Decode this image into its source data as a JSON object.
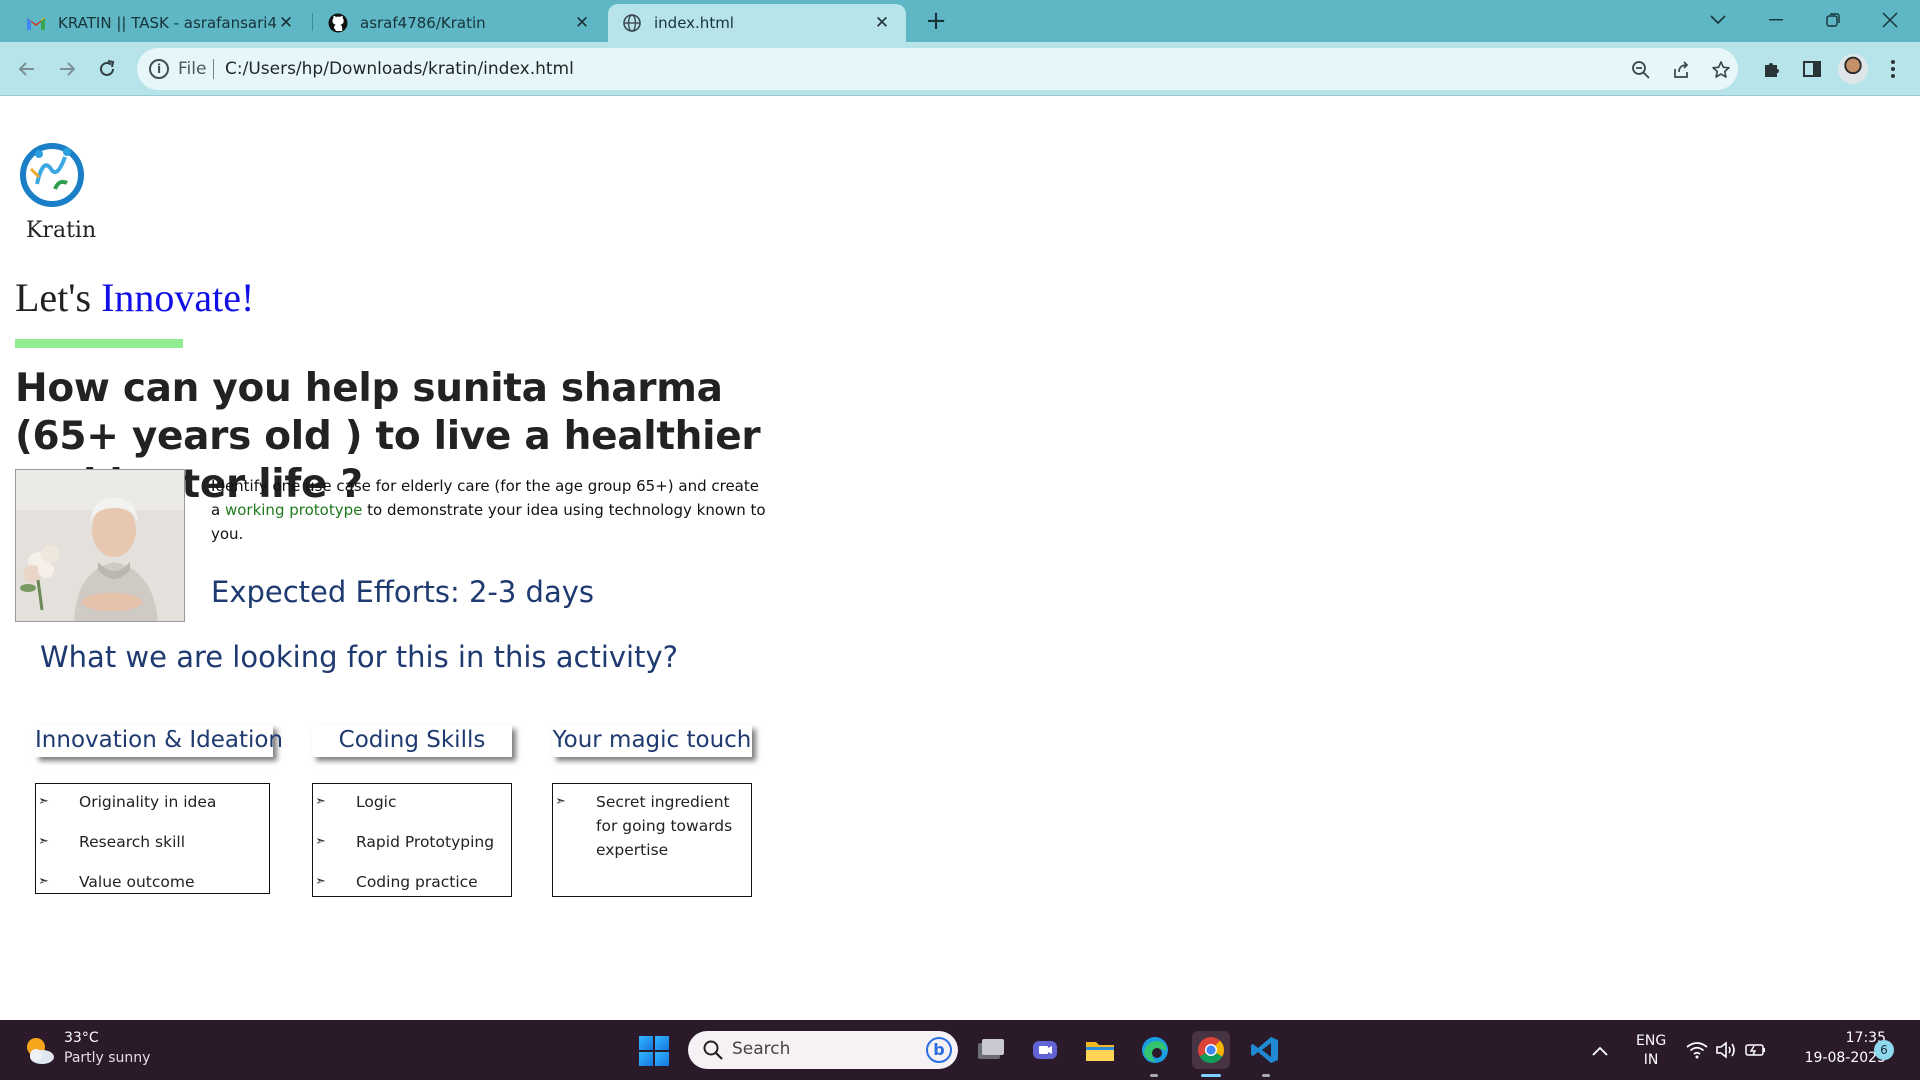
{
  "browser": {
    "tabs": [
      {
        "title": "KRATIN || TASK - asrafansari4786",
        "favicon": "gmail-icon",
        "active": false
      },
      {
        "title": "asraf4786/Kratin",
        "favicon": "github-icon",
        "active": false
      },
      {
        "title": "index.html",
        "favicon": "globe-icon",
        "active": true
      }
    ],
    "address_scheme": "File",
    "address_url": "C:/Users/hp/Downloads/kratin/index.html"
  },
  "page": {
    "logo_text": "Kratin",
    "tagline_prefix": "Let's ",
    "tagline_accent": "Innovate!",
    "challenge": "How can you help sunita sharma (65+ years old ) to live a healthier and better life ?",
    "description_before": "Identify one use case for elderly care (for the age group 65+) and create a ",
    "description_highlight": "working prototype",
    "description_after": " to demonstrate your idea using technology known to you.",
    "efforts": "Expected Efforts: 2-3 days",
    "looking_for": "What we are looking for this in this activity?",
    "cards": [
      {
        "title": "Innovation & Ideation",
        "items": [
          "Originality in idea",
          "Research skill",
          "Value outcome"
        ]
      },
      {
        "title": "Coding Skills",
        "items": [
          "Logic",
          "Rapid Prototyping",
          "Coding practice"
        ]
      },
      {
        "title": "Your magic touch",
        "items": [
          "Secret ingredient for going towards expertise"
        ]
      }
    ],
    "colors": {
      "accent_blue": "#1010e6",
      "heading_navy": "#1e3a70",
      "highlight_green": "#1f7a1f",
      "underline_green": "#90ee90"
    }
  },
  "taskbar": {
    "weather_temp": "33°C",
    "weather_desc": "Partly sunny",
    "search_placeholder": "Search",
    "lang_line1": "ENG",
    "lang_line2": "IN",
    "time": "17:35",
    "date": "19-08-2023",
    "notification_count": "6"
  }
}
